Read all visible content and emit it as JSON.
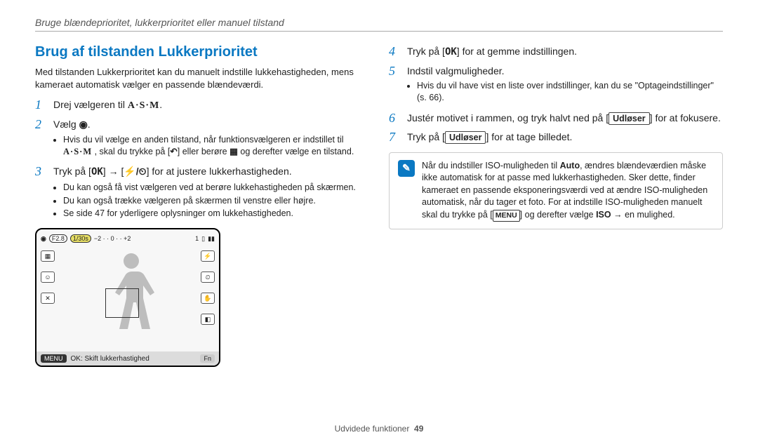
{
  "breadcrumb": "Bruge blændeprioritet, lukkerprioritet eller manuel tilstand",
  "section_title": "Brug af tilstanden Lukkerprioritet",
  "intro": "Med tilstanden Lukkerprioritet kan du manuelt indstille lukkehastigheden, mens kameraet automatisk vælger en passende blændeværdi.",
  "steps": {
    "s1": "Drej vælgeren til ",
    "s1_icon": "A·S·M",
    "s2": "Vælg ",
    "s2_bullet_a_pre": "Hvis du vil vælge en anden tilstand, når funktionsvælgeren er indstillet til ",
    "s2_bullet_a_mid": ", skal du trykke på [",
    "s2_bullet_a_back": "] eller berøre ",
    "s2_bullet_a_end": " og derefter vælge en tilstand.",
    "s3_pre": "Tryk på [",
    "s3_ok": "OK",
    "s3_mid": "] → [",
    "s3_icons": "⚡/⏲",
    "s3_end": "] for at justere lukkerhastigheden.",
    "s3_bullets": [
      "Du kan også få vist vælgeren ved at berøre lukkehastigheden på skærmen.",
      "Du kan også trække vælgeren på skærmen til venstre eller højre.",
      "Se side 47 for yderligere oplysninger om lukkehastigheden."
    ],
    "s4_pre": "Tryk på [",
    "s4_ok": "OK",
    "s4_end": "] for at gemme indstillingen.",
    "s5": "Indstil valgmuligheder.",
    "s5_bullet": "Hvis du vil have vist en liste over indstillinger, kan du se \"Optageindstillinger\" (s. 66).",
    "s6_pre": "Justér motivet i rammen, og tryk halvt ned på [",
    "s6_btn": "Udløser",
    "s6_end": "] for at fokusere.",
    "s7_pre": "Tryk på [",
    "s7_btn": "Udløser",
    "s7_end": "] for at tage billedet."
  },
  "info": {
    "pre": "Når du indstiller ISO-muligheden til ",
    "auto": "Auto",
    "mid": ", ændres blændeværdien måske ikke automatisk for at passe med lukkerhastigheden. Sker dette, finder kameraet en passende eksponeringsværdi ved at ændre ISO-muligheden automatisk, når du tager et foto. For at indstille ISO-muligheden manuelt skal du trykke på [",
    "menu": "MENU",
    "mid2": "] og derefter vælge ",
    "iso": "ISO",
    "end": " → en mulighed."
  },
  "lcd": {
    "f": "F2.8",
    "shutter": "1/30s",
    "ev_scale": "−2 · · 0 · · +2",
    "count": "1",
    "menu": "MENU",
    "hint": "OK: Skift lukkerhastighed",
    "fn": "Fn"
  },
  "footer": {
    "section": "Udvidede funktioner",
    "page": "49"
  },
  "glyphs": {
    "asm": "A·S·M",
    "mode_dot": "◉",
    "back": "↶",
    "home": "▦"
  }
}
